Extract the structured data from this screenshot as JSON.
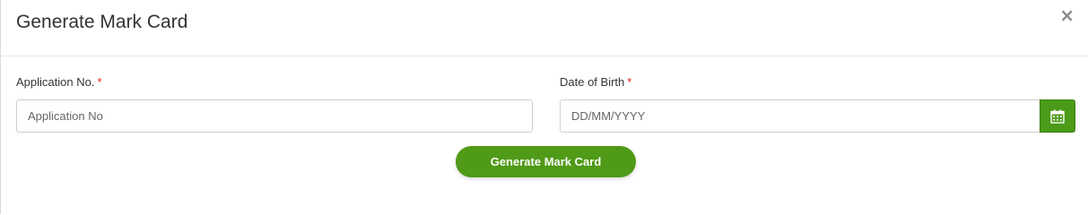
{
  "modal": {
    "title": "Generate Mark Card",
    "close_symbol": "×"
  },
  "form": {
    "application_no": {
      "label": "Application No.",
      "required_mark": "*",
      "placeholder": "Application No",
      "value": ""
    },
    "date_of_birth": {
      "label": "Date of Birth",
      "required_mark": "*",
      "placeholder": "DD/MM/YYYY",
      "value": "",
      "picker_icon": "calendar-icon"
    },
    "submit_label": "Generate Mark Card"
  },
  "colors": {
    "accent_green": "#4f9a16",
    "required_red": "#e02020"
  }
}
